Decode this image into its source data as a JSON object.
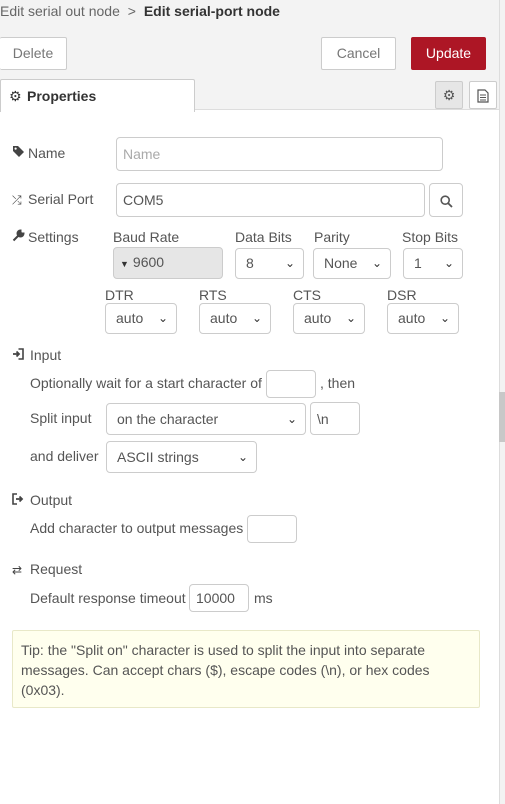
{
  "header": {
    "breadcrumb_parent": "Edit serial out node",
    "breadcrumb_sep": ">",
    "breadcrumb_current": "Edit serial-port node",
    "delete_label": "Delete",
    "cancel_label": "Cancel",
    "update_label": "Update",
    "accent_color": "#ad1625"
  },
  "tabs": {
    "properties_label": "Properties",
    "gear_icon": "gear-icon",
    "doc_icon": "document-icon"
  },
  "form": {
    "name_label": "Name",
    "name_placeholder": "Name",
    "serial_port_label": "Serial Port",
    "serial_port_value": "COM5",
    "settings_label": "Settings",
    "baud_rate_label": "Baud Rate",
    "baud_rate_value": "9600",
    "data_bits_label": "Data Bits",
    "data_bits_value": "8",
    "parity_label": "Parity",
    "parity_value": "None",
    "stop_bits_label": "Stop Bits",
    "stop_bits_value": "1",
    "dtr_label": "DTR",
    "dtr_value": "auto",
    "rts_label": "RTS",
    "rts_value": "auto",
    "cts_label": "CTS",
    "cts_value": "auto",
    "dsr_label": "DSR",
    "dsr_value": "auto"
  },
  "input_section": {
    "title": "Input",
    "wait_text": "Optionally wait for a start character of",
    "then_text": ", then",
    "start_char_value": "",
    "split_label": "Split input",
    "split_value": "on the character",
    "split_char_value": "\\n",
    "deliver_label": "and deliver",
    "deliver_value": "ASCII strings"
  },
  "output_section": {
    "title": "Output",
    "add_char_label": "Add character to output messages",
    "add_char_value": ""
  },
  "request_section": {
    "title": "Request",
    "timeout_label": "Default response timeout",
    "timeout_value": "10000",
    "timeout_unit": "ms"
  },
  "tip": {
    "text": "Tip: the \"Split on\" character is used to split the input into separate messages. Can accept chars ($), escape codes (\\n), or hex codes (0x03)."
  }
}
